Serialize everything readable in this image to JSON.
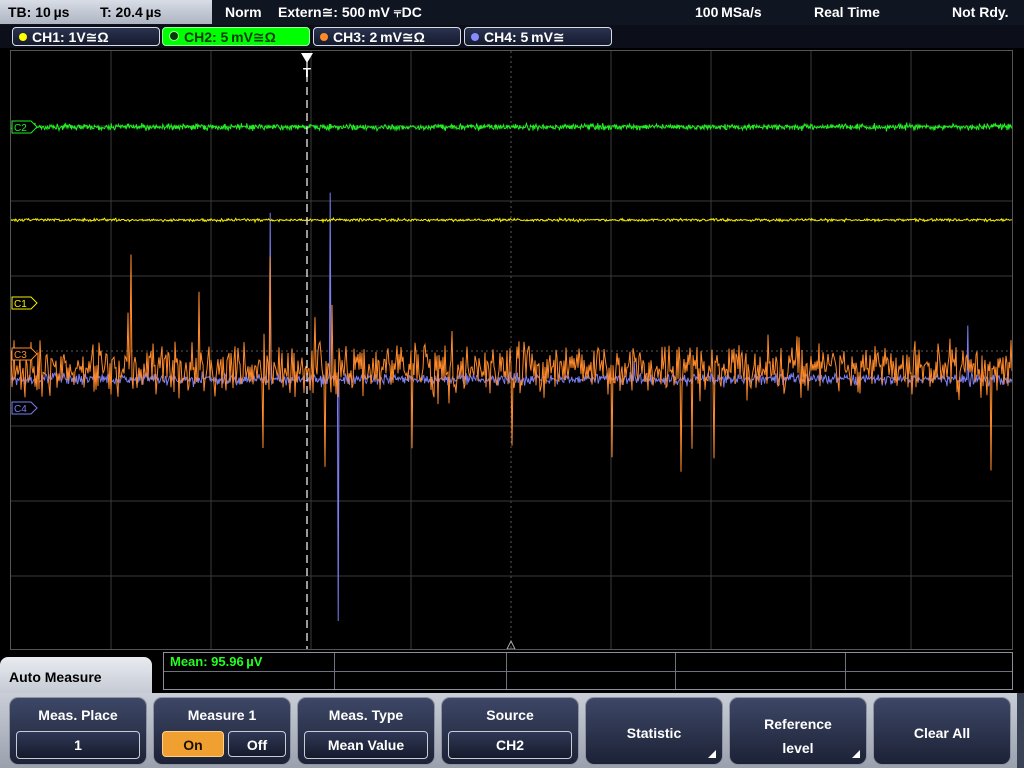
{
  "status": {
    "timebase": "TB: 10 µs",
    "trigger_time": "T: 20.4 µs",
    "acq_mode": "Norm",
    "trigger_source": "Extern≅: 500 mV ⫧DC",
    "sample_rate": "100 MSa/s",
    "time_mode": "Real Time",
    "trigger_state": "Not Rdy."
  },
  "channels": [
    {
      "label": "CH1: 1V≅Ω",
      "color": "#ffff00",
      "active": false
    },
    {
      "label": "CH2: 5 mV≅Ω",
      "color": "#00ff00",
      "active": true
    },
    {
      "label": "CH3: 2 mV≅Ω",
      "color": "#ff8c28",
      "active": false
    },
    {
      "label": "CH4: 5 mV≅",
      "color": "#8888ff",
      "active": false
    }
  ],
  "markers": {
    "trigger": "T",
    "c1": "C1",
    "c2": "C2",
    "c3": "C3",
    "c4": "C4"
  },
  "measurement": {
    "readout": "Mean: 95.96 µV",
    "color": "#22ff22"
  },
  "menu": {
    "title": "Auto Measure",
    "keys": {
      "meas_place": {
        "title": "Meas. Place",
        "value": "1"
      },
      "measure1": {
        "title": "Measure 1",
        "on": "On",
        "off": "Off"
      },
      "meas_type": {
        "title": "Meas. Type",
        "value": "Mean Value"
      },
      "source": {
        "title": "Source",
        "value": "CH2"
      },
      "statistic": {
        "title": "Statistic"
      },
      "reference": {
        "line1": "Reference",
        "line2": "level"
      },
      "clear_all": {
        "title": "Clear All"
      }
    }
  }
}
